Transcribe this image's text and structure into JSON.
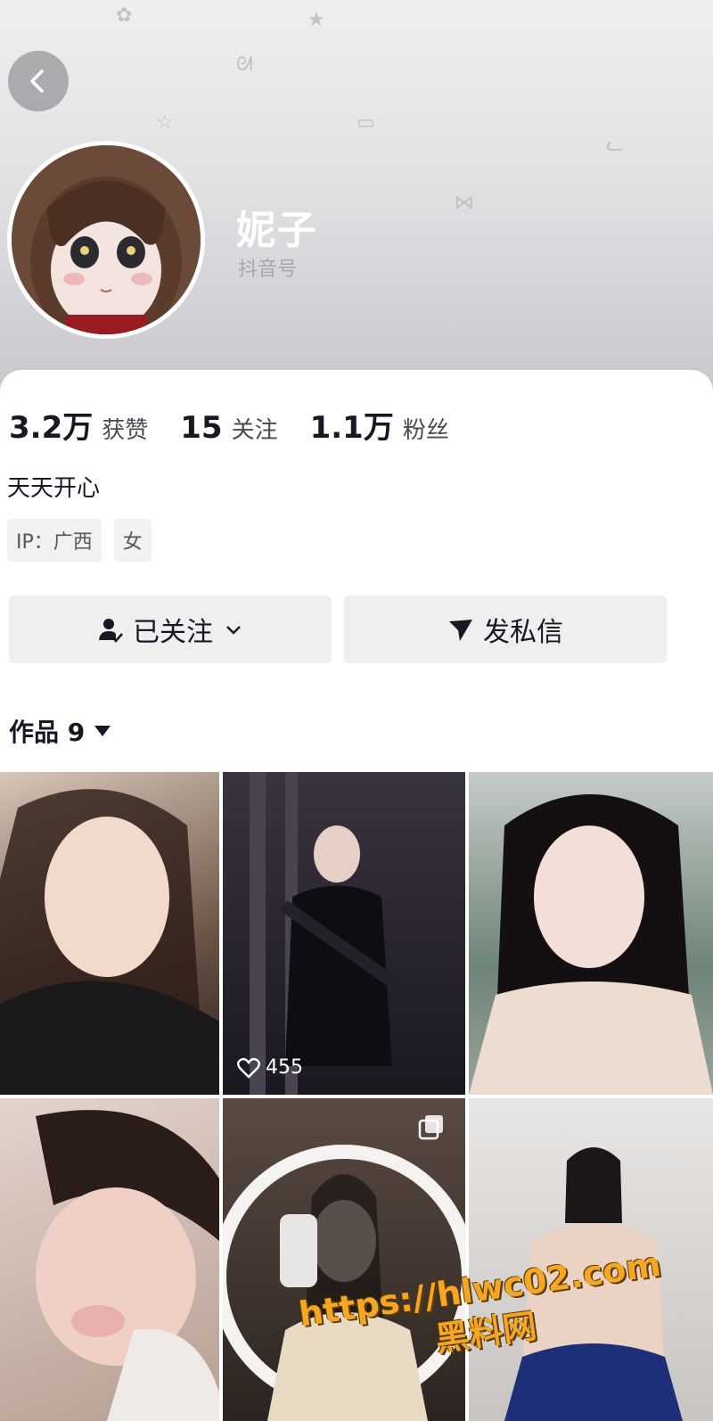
{
  "profile": {
    "name": "妮子",
    "douyin_id_label": "抖音号",
    "bio": "天天开心"
  },
  "stats": [
    {
      "value": "3.2万",
      "label": "获赞"
    },
    {
      "value": "15",
      "label": "关注"
    },
    {
      "value": "1.1万",
      "label": "粉丝"
    }
  ],
  "tags": [
    "IP：广西",
    "女"
  ],
  "actions": {
    "follow_label": "已关注",
    "message_label": "发私信"
  },
  "works": {
    "tab_label": "作品 9"
  },
  "grid": [
    {
      "likes": ""
    },
    {
      "likes": "455"
    },
    {
      "likes": ""
    },
    {
      "likes": ""
    },
    {
      "likes": ""
    },
    {
      "likes": ""
    }
  ],
  "watermark": {
    "url": "https://hlwc02.com",
    "site": "黑料网"
  },
  "icons": {
    "back": "chevron-left-icon",
    "follow": "user-check-icon",
    "follow_dropdown": "chevron-down-icon",
    "message": "send-icon",
    "works_dropdown": "triangle-down-icon",
    "like": "heart-icon",
    "multi_image": "multi-image-icon"
  }
}
